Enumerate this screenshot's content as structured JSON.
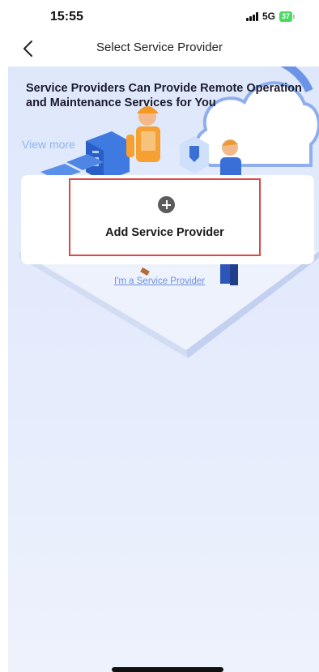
{
  "status_bar": {
    "time": "15:55",
    "network": "5G",
    "battery": "37",
    "signal_icon": "signal-bars-icon"
  },
  "nav": {
    "title": "Select Service Provider",
    "back_icon": "chevron-left-icon"
  },
  "hero": {
    "title": "Service Providers Can Provide Remote Operation and Maintenance Services for You",
    "view_more": "View more"
  },
  "card": {
    "add_label": "Add Service Provider",
    "add_icon": "plus-circle-icon"
  },
  "provider_link": "I'm a Service Provider",
  "colors": {
    "highlight_border": "#e04646",
    "background_top": "#dfe8fb",
    "link": "#6c8fe0",
    "view_more": "#8fb3ec",
    "battery": "#4cd964"
  }
}
